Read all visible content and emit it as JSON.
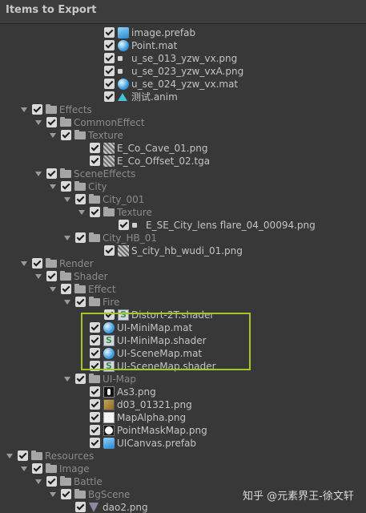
{
  "window": {
    "title": "Items to Export"
  },
  "rows": [
    {
      "label": "image.prefab",
      "kind": "file",
      "icon": "prefab-icon",
      "depth": 6,
      "dim": false
    },
    {
      "label": "Point.mat",
      "kind": "file",
      "icon": "material-icon",
      "depth": 6,
      "dim": false
    },
    {
      "label": "u_se_013_yzw_vx.png",
      "kind": "file",
      "icon": "texture-icon",
      "depth": 6,
      "dim": false
    },
    {
      "label": "u_se_023_yzw_vxA.png",
      "kind": "file",
      "icon": "texture-icon",
      "depth": 6,
      "dim": false
    },
    {
      "label": "u_se_024_yzw_vx.mat",
      "kind": "file",
      "icon": "material-icon",
      "depth": 6,
      "dim": false
    },
    {
      "label": "测试.anim",
      "kind": "file",
      "icon": "animation-icon",
      "depth": 6,
      "dim": false
    },
    {
      "label": "Effects",
      "kind": "folder",
      "depth": 1,
      "dim": true
    },
    {
      "label": "CommonEffect",
      "kind": "folder",
      "depth": 2,
      "dim": true
    },
    {
      "label": "Texture",
      "kind": "folder",
      "depth": 3,
      "dim": true
    },
    {
      "label": "E_Co_Cave_01.png",
      "kind": "file",
      "icon": "texture-icon",
      "depth": 5,
      "dim": false
    },
    {
      "label": "E_Co_Offset_02.tga",
      "kind": "file",
      "icon": "texture-icon",
      "depth": 5,
      "dim": false
    },
    {
      "label": "SceneEffects",
      "kind": "folder",
      "depth": 2,
      "dim": true
    },
    {
      "label": "City",
      "kind": "folder",
      "depth": 3,
      "dim": true
    },
    {
      "label": "City_001",
      "kind": "folder",
      "depth": 4,
      "dim": true
    },
    {
      "label": "Texture",
      "kind": "folder",
      "depth": 5,
      "dim": true
    },
    {
      "label": "E_SE_City_lens flare_04_00094.png",
      "kind": "file",
      "icon": "texture-icon",
      "depth": 7,
      "dim": false
    },
    {
      "label": "City_HB_01",
      "kind": "folder",
      "depth": 4,
      "dim": true
    },
    {
      "label": "S_city_hb_wudi_01.png",
      "kind": "file",
      "icon": "texture-icon",
      "depth": 6,
      "dim": false
    },
    {
      "label": "Render",
      "kind": "folder",
      "depth": 1,
      "dim": true
    },
    {
      "label": "Shader",
      "kind": "folder",
      "depth": 2,
      "dim": true
    },
    {
      "label": "Effect",
      "kind": "folder",
      "depth": 3,
      "dim": true
    },
    {
      "label": "Fire",
      "kind": "folder",
      "depth": 4,
      "dim": true
    },
    {
      "label": "Distort-2T.shader",
      "kind": "file",
      "icon": "shader-icon",
      "depth": 6,
      "dim": false
    },
    {
      "label": "UI-MiniMap.mat",
      "kind": "file",
      "icon": "material-icon",
      "depth": 5,
      "dim": false
    },
    {
      "label": "UI-MiniMap.shader",
      "kind": "file",
      "icon": "shader-icon",
      "depth": 5,
      "dim": false
    },
    {
      "label": "UI-SceneMap.mat",
      "kind": "file",
      "icon": "material-icon",
      "depth": 5,
      "dim": false
    },
    {
      "label": "UI-SceneMap.shader",
      "kind": "file",
      "icon": "shader-icon",
      "depth": 5,
      "dim": false
    },
    {
      "label": "UI-Map",
      "kind": "folder",
      "depth": 4,
      "dim": true
    },
    {
      "label": "As3.png",
      "kind": "file",
      "icon": "texture-icon",
      "depth": 5,
      "dim": false
    },
    {
      "label": "d03_01321.png",
      "kind": "file",
      "icon": "texture-icon",
      "depth": 5,
      "dim": false
    },
    {
      "label": "MapAlpha.png",
      "kind": "file",
      "icon": "texture-icon",
      "depth": 5,
      "dim": false
    },
    {
      "label": "PointMaskMap.png",
      "kind": "file",
      "icon": "texture-icon",
      "depth": 5,
      "dim": false
    },
    {
      "label": "UICanvas.prefab",
      "kind": "file",
      "icon": "prefab-icon",
      "depth": 5,
      "dim": false
    },
    {
      "label": "Resources",
      "kind": "folder",
      "depth": 0,
      "dim": true
    },
    {
      "label": "Image",
      "kind": "folder",
      "depth": 1,
      "dim": true
    },
    {
      "label": "Battle",
      "kind": "folder",
      "depth": 2,
      "dim": true
    },
    {
      "label": "BgScene",
      "kind": "folder",
      "depth": 3,
      "dim": true
    },
    {
      "label": "dao2.png",
      "kind": "file",
      "icon": "texture-icon",
      "depth": 4,
      "dim": false
    }
  ],
  "watermark": "知乎 @元素界王-徐文轩",
  "colors": {
    "highlight": "#a3c62a",
    "background": "#383838",
    "checkbox": "#dadada"
  }
}
